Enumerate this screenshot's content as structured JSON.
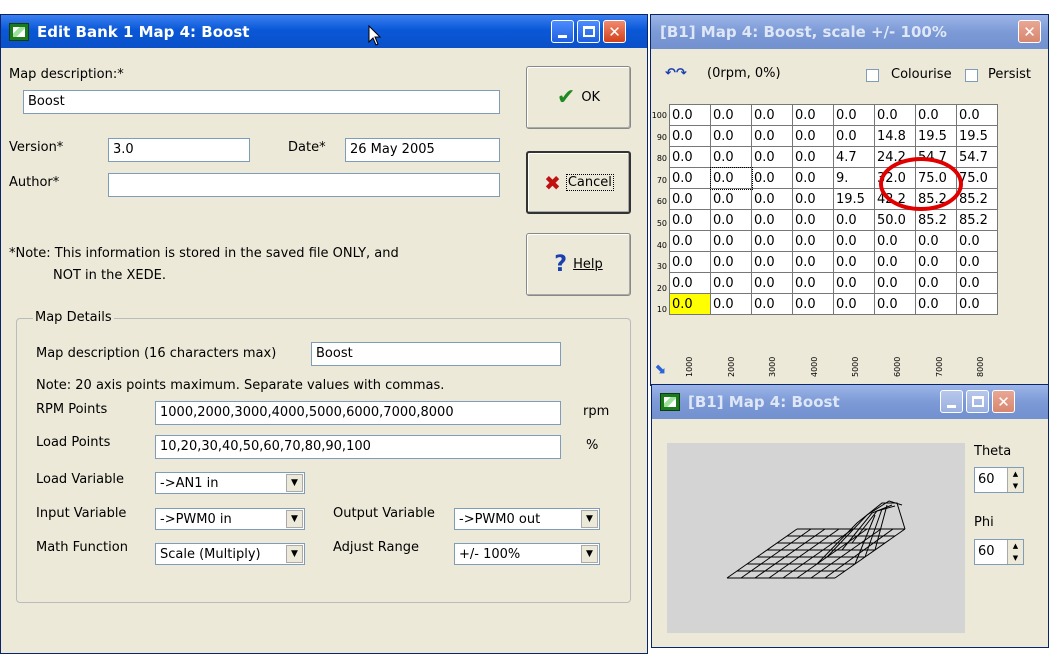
{
  "edit_dialog": {
    "title": "Edit Bank 1 Map 4: Boost",
    "map_description_label": "Map description:*",
    "map_description_value": "Boost",
    "version_label": "Version*",
    "version_value": "3.0",
    "date_label": "Date*",
    "date_value": "26 May 2005",
    "author_label": "Author*",
    "author_value": "",
    "note_line1": "*Note: This information is stored in the saved file ONLY, and",
    "note_line2": "NOT in the XEDE.",
    "ok_label": "OK",
    "cancel_label": "Cancel",
    "help_label": "Help",
    "details": {
      "group_label": "Map Details",
      "desc16_label": "Map description (16 characters max)",
      "desc16_value": "Boost",
      "axis_note": "Note: 20 axis points maximum.  Separate values with commas.",
      "rpm_label": "RPM Points",
      "rpm_value": "1000,2000,3000,4000,5000,6000,7000,8000",
      "rpm_unit": "rpm",
      "load_label": "Load Points",
      "load_value": "10,20,30,40,50,60,70,80,90,100",
      "load_unit": "%",
      "load_var_label": "Load Variable",
      "load_var_value": "->AN1 in",
      "input_var_label": "Input Variable",
      "input_var_value": "->PWM0 in",
      "output_var_label": "Output Variable",
      "output_var_value": "->PWM0 out",
      "math_label": "Math Function",
      "math_value": "Scale (Multiply)",
      "adjust_label": "Adjust Range",
      "adjust_value": "+/- 100%"
    }
  },
  "map_window": {
    "title": "[B1] Map 4: Boost, scale +/- 100%",
    "cursor_readout": "(0rpm, 0%)",
    "colourise_label": "Colourise",
    "persist_label": "Persist",
    "row_labels": [
      "100",
      "90",
      "80",
      "70",
      "60",
      "50",
      "40",
      "30",
      "20",
      "10"
    ],
    "col_labels": [
      "1000",
      "2000",
      "3000",
      "4000",
      "5000",
      "6000",
      "7000",
      "8000"
    ],
    "rows": [
      [
        "0.0",
        "0.0",
        "0.0",
        "0.0",
        "0.0",
        "0.0",
        "0.0",
        "0.0"
      ],
      [
        "0.0",
        "0.0",
        "0.0",
        "0.0",
        "0.0",
        "14.8",
        "19.5",
        "19.5"
      ],
      [
        "0.0",
        "0.0",
        "0.0",
        "0.0",
        "4.7",
        "24.2",
        "54.7",
        "54.7"
      ],
      [
        "0.0",
        "0.0",
        "0.0",
        "0.0",
        "9.",
        "32.0",
        "75.0",
        "75.0"
      ],
      [
        "0.0",
        "0.0",
        "0.0",
        "0.0",
        "19.5",
        "42.2",
        "85.2",
        "85.2"
      ],
      [
        "0.0",
        "0.0",
        "0.0",
        "0.0",
        "0.0",
        "50.0",
        "85.2",
        "85.2"
      ],
      [
        "0.0",
        "0.0",
        "0.0",
        "0.0",
        "0.0",
        "0.0",
        "0.0",
        "0.0"
      ],
      [
        "0.0",
        "0.0",
        "0.0",
        "0.0",
        "0.0",
        "0.0",
        "0.0",
        "0.0"
      ],
      [
        "0.0",
        "0.0",
        "0.0",
        "0.0",
        "0.0",
        "0.0",
        "0.0",
        "0.0"
      ],
      [
        "0.0",
        "0.0",
        "0.0",
        "0.0",
        "0.0",
        "0.0",
        "0.0",
        "0.0"
      ]
    ],
    "highlight_color": "#ffff00",
    "annotation_color": "#e00000"
  },
  "plot_window": {
    "title": "[B1] Map 4: Boost",
    "theta_label": "Theta",
    "theta_value": "60",
    "phi_label": "Phi",
    "phi_value": "60"
  }
}
